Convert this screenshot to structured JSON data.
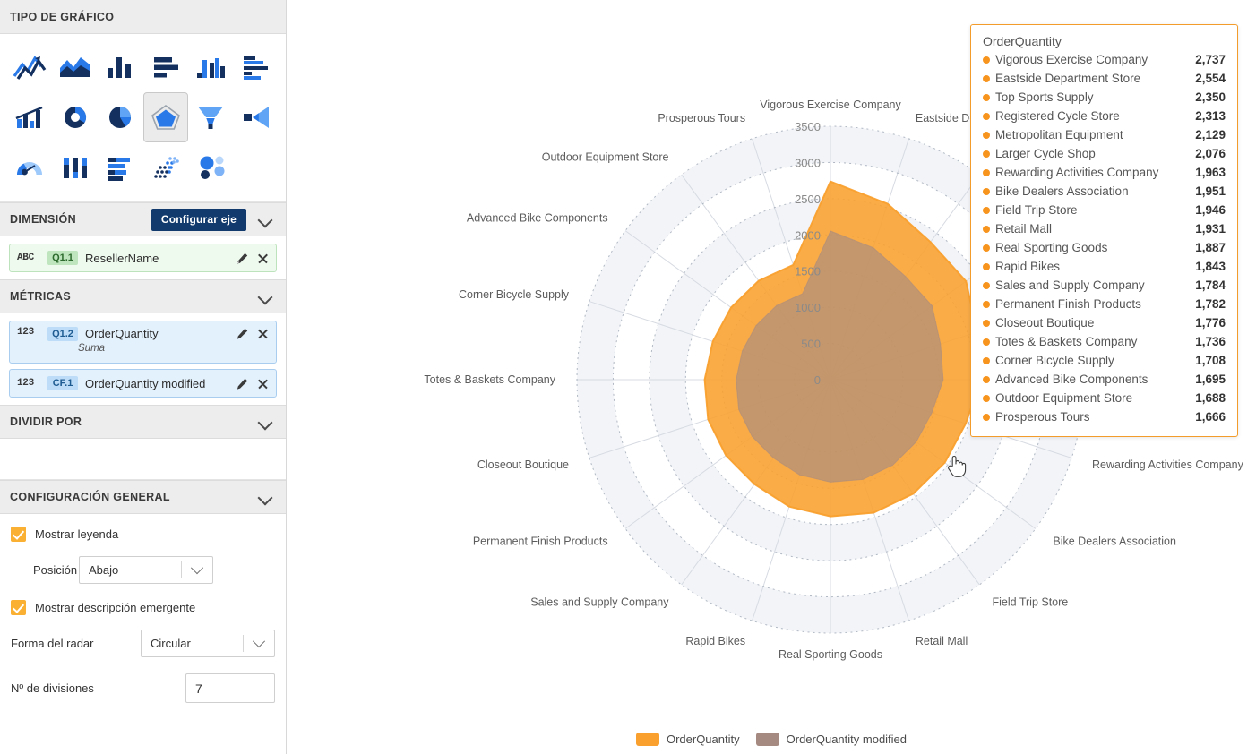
{
  "sidebar": {
    "chart_type": {
      "title": "TIPO DE GRÁFICO",
      "icons": [
        {
          "name": "line-chart-icon",
          "selected": false
        },
        {
          "name": "area-chart-icon",
          "selected": false
        },
        {
          "name": "column-chart-icon",
          "selected": false
        },
        {
          "name": "bar-chart-icon",
          "selected": false
        },
        {
          "name": "grouped-column-chart-icon",
          "selected": false
        },
        {
          "name": "grouped-bar-chart-icon",
          "selected": false
        },
        {
          "name": "combo-chart-icon",
          "selected": false
        },
        {
          "name": "donut-chart-icon",
          "selected": false
        },
        {
          "name": "pie-chart-icon",
          "selected": false
        },
        {
          "name": "radar-chart-icon",
          "selected": true
        },
        {
          "name": "funnel-chart-icon",
          "selected": false
        },
        {
          "name": "pyramid-chart-icon",
          "selected": false
        },
        {
          "name": "gauge-chart-icon",
          "selected": false
        },
        {
          "name": "stacked-column-chart-icon",
          "selected": false
        },
        {
          "name": "stacked-bar-chart-icon",
          "selected": false
        },
        {
          "name": "dot-density-chart-icon",
          "selected": false
        },
        {
          "name": "bubble-chart-icon",
          "selected": false
        }
      ]
    },
    "dimension": {
      "title": "DIMENSIÓN",
      "configure_axis_label": "Configurar eje",
      "fields": [
        {
          "type": "ABC",
          "badge": "Q1.1",
          "name": "ResellerName",
          "sub": ""
        }
      ]
    },
    "metrics": {
      "title": "MÉTRICAS",
      "fields": [
        {
          "type": "123",
          "badge": "Q1.2",
          "name": "OrderQuantity",
          "sub": "Suma"
        },
        {
          "type": "123",
          "badge": "CF.1",
          "name": "OrderQuantity modified",
          "sub": ""
        }
      ]
    },
    "split_by": {
      "title": "DIVIDIR POR"
    },
    "general": {
      "title": "CONFIGURACIÓN GENERAL",
      "show_legend_label": "Mostrar leyenda",
      "show_legend_checked": true,
      "position_label": "Posición",
      "position_value": "Abajo",
      "show_tooltip_label": "Mostrar descripción emergente",
      "show_tooltip_checked": true,
      "radar_shape_label": "Forma del radar",
      "radar_shape_value": "Circular",
      "divisions_label": "Nº de divisiones",
      "divisions_value": "7"
    }
  },
  "tooltip": {
    "title": "OrderQuantity",
    "rows": [
      {
        "label": "Vigorous Exercise Company",
        "value": "2,737"
      },
      {
        "label": "Eastside Department Store",
        "value": "2,554"
      },
      {
        "label": "Top Sports Supply",
        "value": "2,350"
      },
      {
        "label": "Registered Cycle Store",
        "value": "2,313"
      },
      {
        "label": "Metropolitan Equipment",
        "value": "2,129"
      },
      {
        "label": "Larger Cycle Shop",
        "value": "2,076"
      },
      {
        "label": "Rewarding Activities Company",
        "value": "1,963"
      },
      {
        "label": "Bike Dealers Association",
        "value": "1,951"
      },
      {
        "label": "Field Trip Store",
        "value": "1,946"
      },
      {
        "label": "Retail Mall",
        "value": "1,931"
      },
      {
        "label": "Real Sporting Goods",
        "value": "1,887"
      },
      {
        "label": "Rapid Bikes",
        "value": "1,843"
      },
      {
        "label": "Sales and Supply Company",
        "value": "1,784"
      },
      {
        "label": "Permanent Finish Products",
        "value": "1,782"
      },
      {
        "label": "Closeout Boutique",
        "value": "1,776"
      },
      {
        "label": "Totes & Baskets Company",
        "value": "1,736"
      },
      {
        "label": "Corner Bicycle Supply",
        "value": "1,708"
      },
      {
        "label": "Advanced Bike Components",
        "value": "1,695"
      },
      {
        "label": "Outdoor Equipment Store",
        "value": "1,688"
      },
      {
        "label": "Prosperous Tours",
        "value": "1,666"
      }
    ]
  },
  "legend": {
    "items": [
      {
        "label": "OrderQuantity",
        "color": "#F9A02E"
      },
      {
        "label": "OrderQuantity modified",
        "color": "#A58A82"
      }
    ]
  },
  "chart_data": {
    "type": "radar",
    "title": "",
    "shape": "circular",
    "divisions": 7,
    "rlim": [
      0,
      3500
    ],
    "rticks": [
      0,
      500,
      1000,
      1500,
      2000,
      2500,
      3000,
      3500
    ],
    "grid": true,
    "legend_position": "bottom",
    "categories": [
      "Vigorous Exercise Company",
      "Eastside Department Store",
      "Top Sports Supply",
      "Registered Cycle Store",
      "Metropolitan Equipment",
      "Larger Cycle Shop",
      "Rewarding Activities Company",
      "Bike Dealers Association",
      "Field Trip Store",
      "Retail Mall",
      "Real Sporting Goods",
      "Rapid Bikes",
      "Sales and Supply Company",
      "Permanent Finish Products",
      "Closeout Boutique",
      "Totes & Baskets Company",
      "Corner Bicycle Supply",
      "Advanced Bike Components",
      "Outdoor Equipment Store",
      "Prosperous Tours"
    ],
    "series": [
      {
        "name": "OrderQuantity",
        "color": "#F9A02E",
        "values": [
          2737,
          2554,
          2350,
          2313,
          2129,
          2076,
          1963,
          1951,
          1946,
          1931,
          1887,
          1843,
          1784,
          1782,
          1776,
          1736,
          1708,
          1695,
          1688,
          1666
        ]
      },
      {
        "name": "OrderQuantity modified",
        "color": "#A58A82",
        "values": [
          2053,
          1916,
          1763,
          1735,
          1597,
          1557,
          1472,
          1463,
          1460,
          1448,
          1415,
          1382,
          1338,
          1337,
          1332,
          1302,
          1281,
          1271,
          1266,
          1250
        ]
      }
    ]
  }
}
